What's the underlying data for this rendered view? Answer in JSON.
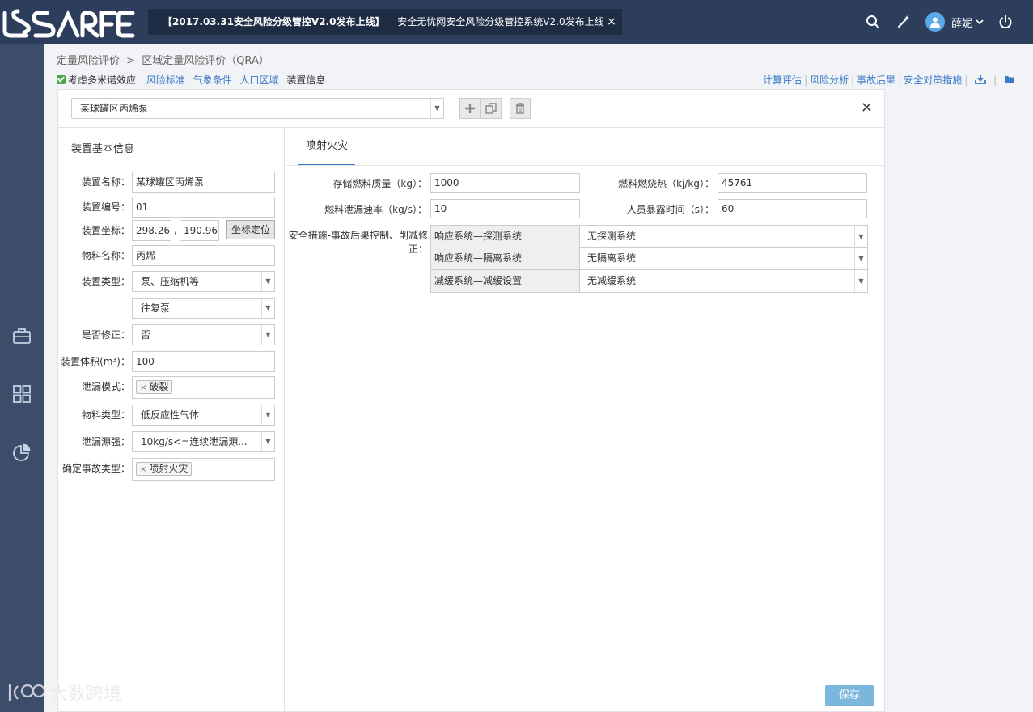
{
  "topbar": {
    "logo": "LSAFE",
    "notice_highlight": "【2017.03.31安全风险分级管控V2.0发布上线】",
    "notice_text": "安全无忧网安全风险分级管控系统V2.0发布上线",
    "notice_close": "×",
    "user_name": "薛妮"
  },
  "breadcrumb": {
    "level1": "定量风险评价",
    "sep": ">",
    "level2": "区域定量风险评价（QRA）"
  },
  "options": {
    "domino": "考虑多米诺效应",
    "links": [
      "风险标准",
      "气象条件",
      "人口区域"
    ],
    "current": "装置信息",
    "right_links": [
      "计算评估",
      "风险分析",
      "事故后果",
      "安全对策措施"
    ],
    "sep": "|"
  },
  "device_select": {
    "value": "某球罐区丙烯泵"
  },
  "close_icon": "✕",
  "basic_info": {
    "title": "装置基本信息",
    "fields": {
      "name": {
        "label": "装置名称：",
        "value": "某球罐区丙烯泵"
      },
      "code": {
        "label": "装置编号：",
        "value": "01"
      },
      "coord": {
        "label": "装置坐标：",
        "x": "298.26",
        "sep": ",",
        "y": "190.96",
        "button": "坐标定位"
      },
      "material": {
        "label": "物料名称：",
        "value": "丙烯"
      },
      "type": {
        "label": "装置类型：",
        "value": "泵、压缩机等",
        "sub_value": "往复泵"
      },
      "modify": {
        "label": "是否修正：",
        "value": "否"
      },
      "volume": {
        "label": "装置体积(m³)：",
        "value": "100"
      },
      "leak_mode": {
        "label": "泄漏模式：",
        "tag": "破裂",
        "tag_x": "×"
      },
      "material_type": {
        "label": "物料类型：",
        "value": "低反应性气体"
      },
      "leak_source": {
        "label": "泄漏源强：",
        "value": "10kg/s<=连续泄漏源..."
      },
      "accident_type": {
        "label": "确定事故类型：",
        "tag": "喷射火灾",
        "tag_x": "×"
      }
    }
  },
  "tab": {
    "label": "喷射火灾"
  },
  "params": {
    "fuel_mass": {
      "label": "存储燃料质量（kg）：",
      "value": "1000"
    },
    "fuel_heat": {
      "label": "燃料燃烧热（kj/kg）：",
      "value": "45761"
    },
    "leak_rate": {
      "label": "燃料泄漏速率（kg/s）：",
      "value": "10"
    },
    "exposure_time": {
      "label": "人员暴露时间（s）：",
      "value": "60"
    }
  },
  "safety": {
    "label": "安全措施-事故后果控制、削减修正：",
    "rows": [
      {
        "name": "响应系统—探测系统",
        "value": "无探测系统"
      },
      {
        "name": "响应系统—隔离系统",
        "value": "无隔离系统"
      },
      {
        "name": "减缓系统—减缓设置",
        "value": "无减缓系统"
      }
    ]
  },
  "save_button": "保存",
  "watermark": "大数跨境",
  "colors": {
    "topbar": "#2c3e5c",
    "sidebar": "#3b4d6b",
    "link": "#3a7bc8",
    "save": "#7bb6dc"
  }
}
